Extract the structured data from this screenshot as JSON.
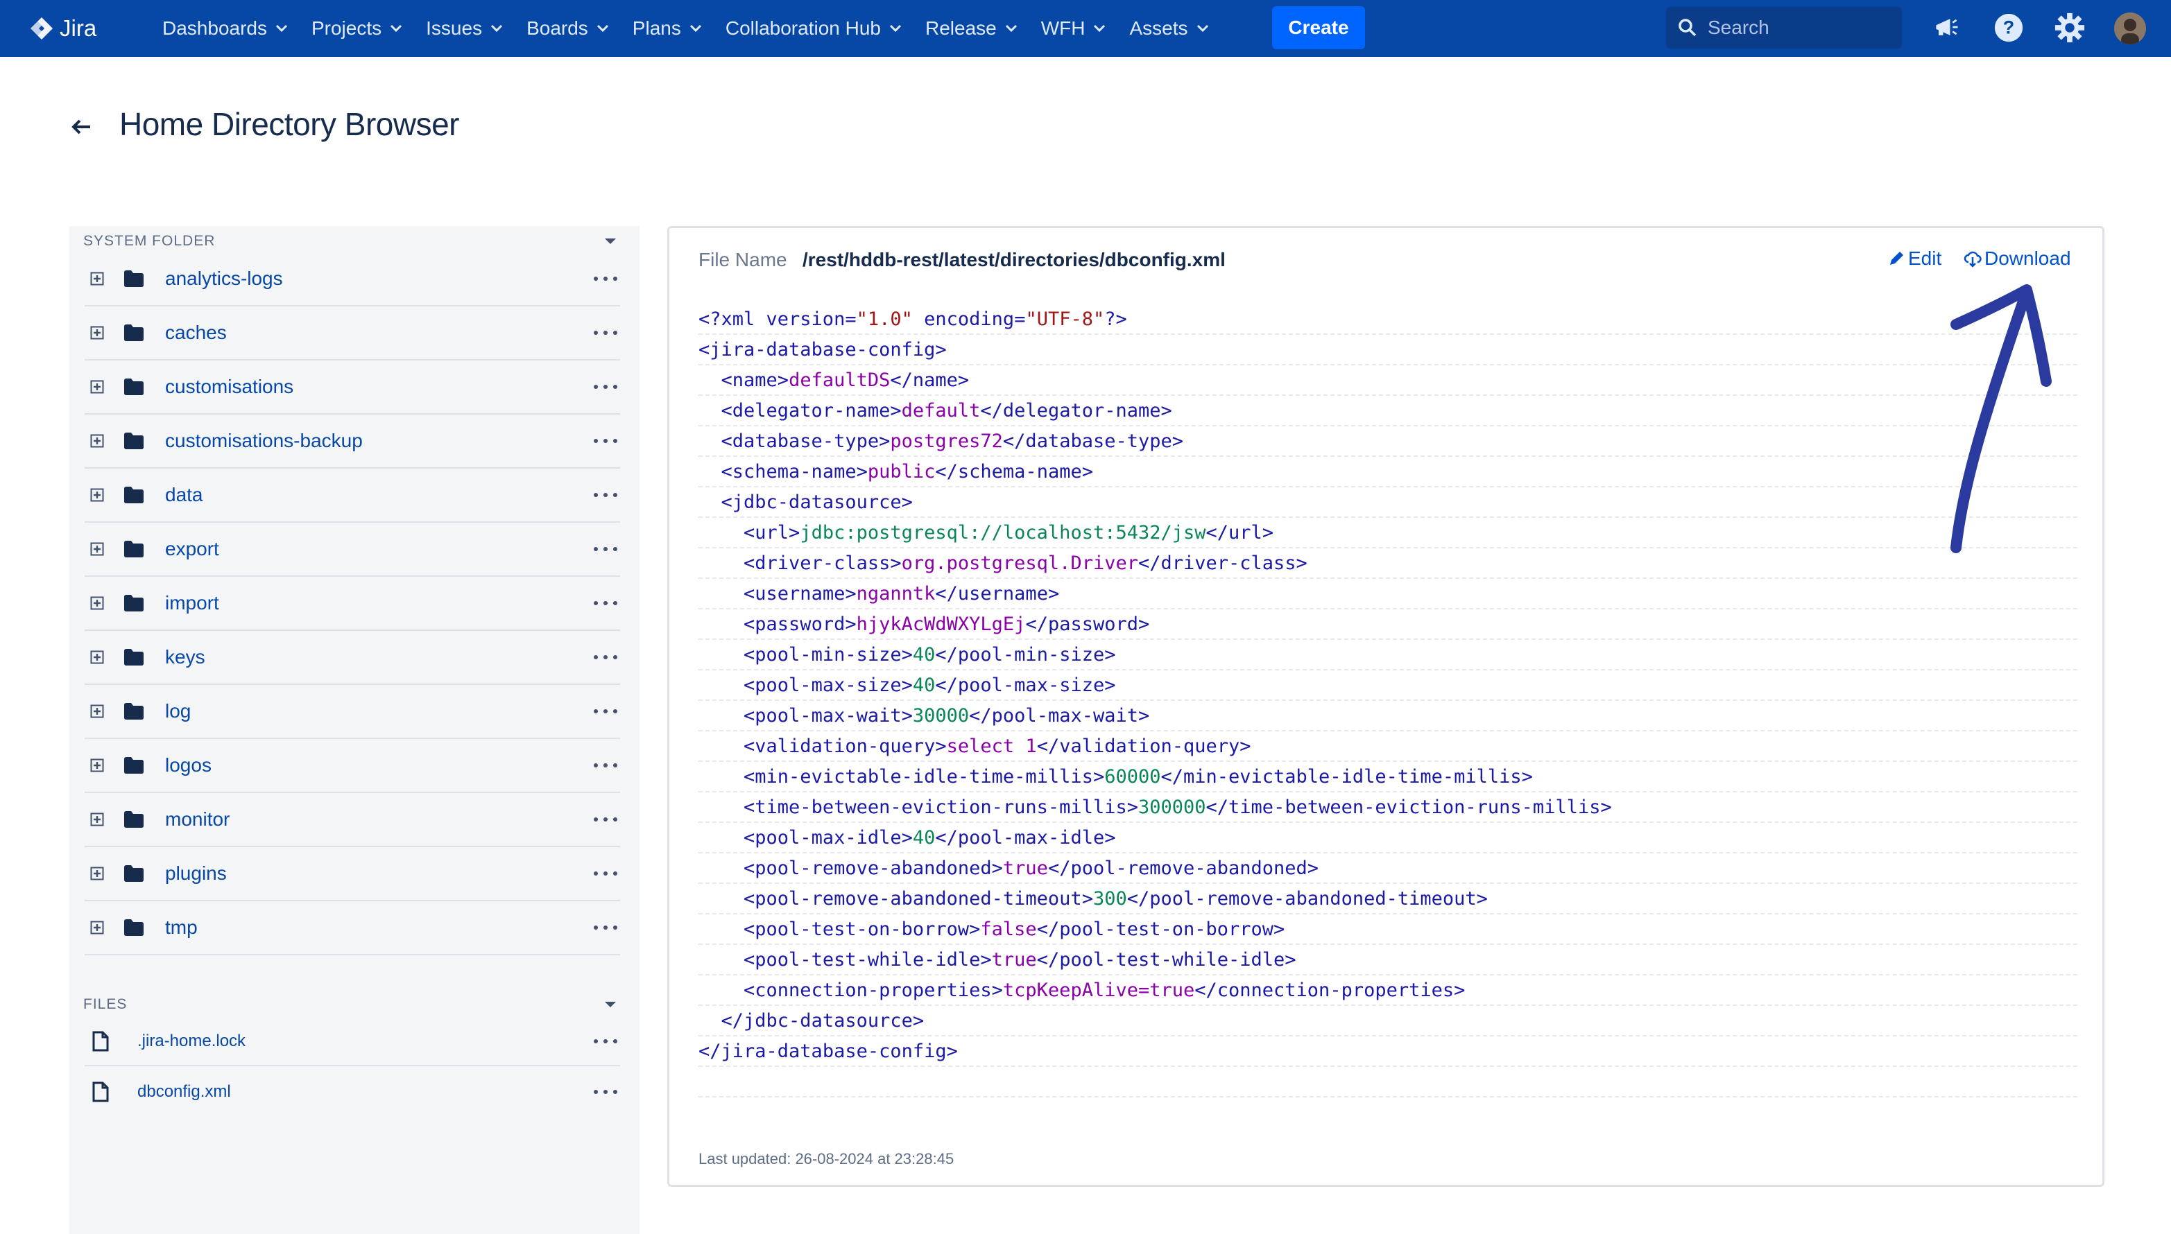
{
  "app": {
    "name": "Jira"
  },
  "nav": {
    "items": [
      {
        "label": "Dashboards"
      },
      {
        "label": "Projects"
      },
      {
        "label": "Issues"
      },
      {
        "label": "Boards"
      },
      {
        "label": "Plans"
      },
      {
        "label": "Collaboration Hub"
      },
      {
        "label": "Release"
      },
      {
        "label": "WFH"
      },
      {
        "label": "Assets"
      }
    ],
    "create_label": "Create",
    "search_placeholder": "Search"
  },
  "page": {
    "title": "Home Directory Browser"
  },
  "sidebar": {
    "system_folder_heading": "SYSTEM FOLDER",
    "folders": [
      {
        "name": "analytics-logs"
      },
      {
        "name": "caches"
      },
      {
        "name": "customisations"
      },
      {
        "name": "customisations-backup"
      },
      {
        "name": "data"
      },
      {
        "name": "export"
      },
      {
        "name": "import"
      },
      {
        "name": "keys"
      },
      {
        "name": "log"
      },
      {
        "name": "logos"
      },
      {
        "name": "monitor"
      },
      {
        "name": "plugins"
      },
      {
        "name": "tmp"
      }
    ],
    "files_heading": "FILES",
    "files": [
      {
        "name": ".jira-home.lock"
      },
      {
        "name": "dbconfig.xml"
      }
    ]
  },
  "viewer": {
    "file_name_label": "File Name",
    "file_path": "/rest/hddb-rest/latest/directories/dbconfig.xml",
    "edit_label": "Edit",
    "download_label": "Download",
    "last_updated": "Last updated: 26-08-2024 at 23:28:45",
    "xml": {
      "declaration": {
        "version": "1.0",
        "encoding": "UTF-8"
      },
      "root": "jira-database-config",
      "name": "defaultDS",
      "delegator_name": "default",
      "database_type": "postgres72",
      "schema_name": "public",
      "datasource": "jdbc-datasource",
      "url": "jdbc:postgresql://localhost:5432/jsw",
      "driver_class": "org.postgresql.Driver",
      "username": "nganntk",
      "password": "hjykAcWdWXYLgEj",
      "pool_min_size": "40",
      "pool_max_size": "40",
      "pool_max_wait": "30000",
      "validation_query": "select 1",
      "min_evictable_idle_time_millis": "60000",
      "time_between_eviction_runs_millis": "300000",
      "pool_max_idle": "40",
      "pool_remove_abandoned": "true",
      "pool_remove_abandoned_timeout": "300",
      "pool_test_on_borrow": "false",
      "pool_test_while_idle": "true",
      "connection_properties": "tcpKeepAlive=true"
    }
  },
  "colors": {
    "nav_bg": "#0747a6",
    "create_bg": "#0065ff",
    "link": "#0052cc",
    "annotation_arrow": "#2b3a9e"
  }
}
